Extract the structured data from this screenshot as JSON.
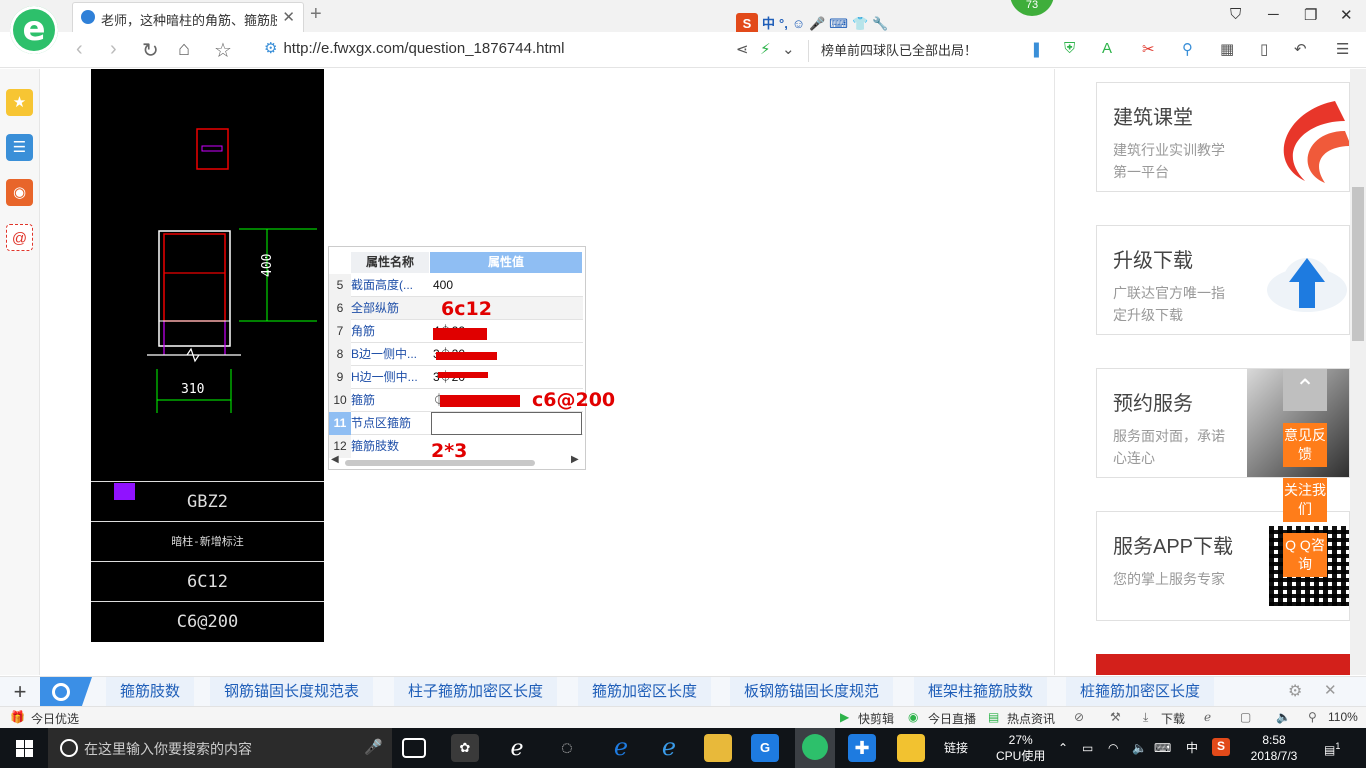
{
  "browser": {
    "tab_title": "老师，这种暗柱的角筋、箍筋肢数",
    "tab_close": "✕",
    "new_tab": "+",
    "url": "http://e.fwxgx.com/question_1876744.html",
    "news_ticker": "榜单前四球队已全部出局！",
    "badge_count": "73",
    "ime_lang": "中",
    "ime_punct": "°,"
  },
  "cad": {
    "dimension_height": "400",
    "dimension_width": "310",
    "labels": [
      "GBZ2",
      "暗柱-新增标注",
      "6C12",
      "C6@200"
    ]
  },
  "property_table": {
    "headers": [
      "属性名称",
      "属性值"
    ],
    "rows": [
      {
        "num": "5",
        "name": "截面高度(...",
        "value": "400"
      },
      {
        "num": "6",
        "name": "全部纵筋",
        "value": ""
      },
      {
        "num": "7",
        "name": "角筋",
        "value": "4⏀22"
      },
      {
        "num": "8",
        "name": "B边一侧中...",
        "value": "3⏀20"
      },
      {
        "num": "9",
        "name": "H边一侧中...",
        "value": "3⏀20"
      },
      {
        "num": "10",
        "name": "箍筋",
        "value": "⏀"
      },
      {
        "num": "11",
        "name": "节点区箍筋",
        "value": ""
      },
      {
        "num": "12",
        "name": "箍筋肢数",
        "value": "2*3"
      }
    ],
    "annotations": {
      "all_bars": "6c12",
      "stirrup": "c6@200",
      "legs": "2*3"
    }
  },
  "ads": [
    {
      "title": "建筑课堂",
      "desc": "建筑行业实训教学第一平台"
    },
    {
      "title": "升级下载",
      "desc": "广联达官方唯一指定升级下载"
    },
    {
      "title": "预约服务",
      "desc": "服务面对面，承诺心连心"
    },
    {
      "title": "服务APP下载",
      "desc": "您的掌上服务专家"
    }
  ],
  "float_buttons": {
    "feedback": "意见反馈",
    "follow": "关注我们",
    "qq": "Q Q咨询"
  },
  "related_searches": [
    "箍筋肢数",
    "钢筋锚固长度规范表",
    "柱子箍筋加密区长度",
    "箍筋加密区长度",
    "板钢筋锚固长度规范",
    "框架柱箍筋肢数",
    "桩箍筋加密区长度"
  ],
  "status_bar": {
    "left": "今日优选",
    "items": [
      "快剪辑",
      "今日直播",
      "热点资讯",
      "下载"
    ],
    "zoom": "110%"
  },
  "taskbar": {
    "search_placeholder": "在这里输入你要搜索的内容",
    "links": "链接",
    "cpu_percent": "27%",
    "cpu_label": "CPU使用",
    "ime": "中",
    "time": "8:58",
    "date": "2018/7/3",
    "notif": "1"
  },
  "colors": {
    "accent_blue": "#3b8fe6",
    "orange": "#ff7d1a",
    "annotation_red": "#e10000",
    "logo_green": "#2dc06b"
  }
}
